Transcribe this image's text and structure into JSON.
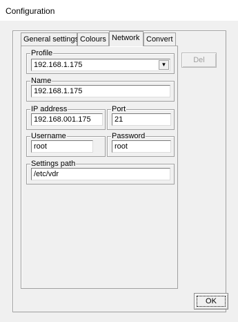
{
  "window": {
    "title": "Configuration"
  },
  "tabs": [
    {
      "label": "General settings",
      "active": false
    },
    {
      "label": "Colours",
      "active": false
    },
    {
      "label": "Network",
      "active": true
    },
    {
      "label": "Convert",
      "active": false
    }
  ],
  "profile": {
    "label": "Profile",
    "value": "192.168.1.175"
  },
  "name": {
    "label": "Name",
    "value": "192.168.1.175"
  },
  "ip_address": {
    "label": "IP address",
    "value": "192.168.001.175"
  },
  "port": {
    "label": "Port",
    "value": "21"
  },
  "username": {
    "label": "Username",
    "value": "root"
  },
  "password": {
    "label": "Password",
    "value": "root"
  },
  "settings_path": {
    "label": "Settings path",
    "value": "/etc/vdr"
  },
  "buttons": {
    "delete": "Del",
    "ok": "OK"
  },
  "icons": {
    "dropdown": "chevron-down-icon"
  }
}
